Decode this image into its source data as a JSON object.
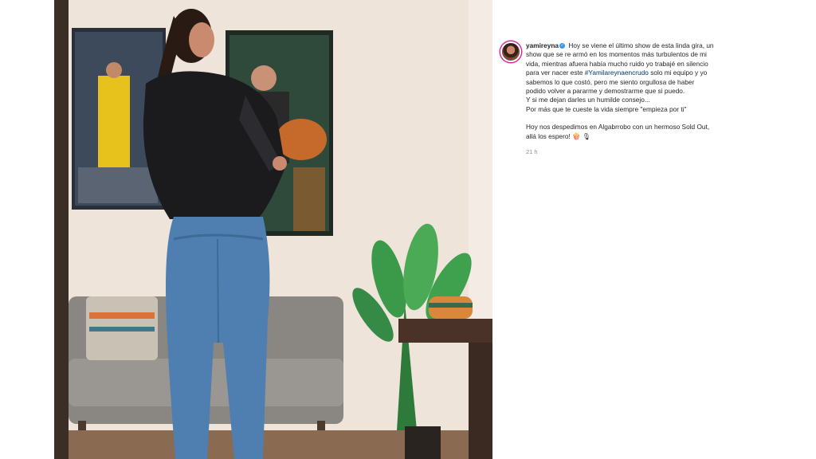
{
  "post": {
    "username": "yamireyna",
    "caption": {
      "first_line_after_user": "Hoy se viene el último show de esta linda gira, un",
      "line2": "show que se re armó en los momentos más turbulentos de mi",
      "line3": "vida, mientras afuera había mucho ruido yo trabajé en silencio",
      "line4_before_tag": "para ver nacer este ",
      "hashtag": "#Yamilareynaencrudo",
      "line4_after_tag": " solo mi equipo y yo",
      "line5": "sabemos lo que costó, pero me siento orgullosa de haber",
      "line6": "podido volver a pararme y demostrarme que si puedo.",
      "line7": "Y si me dejan darles un humilde consejo...",
      "line8": "Por más que te cueste la vida siempre \"empieza por ti\"",
      "line9": "Hoy nos despedimos en Algabrrobo con un hermoso Sold Out,",
      "line10": "allá los espero! 🍿 🎙"
    },
    "timestamp": "21 h"
  }
}
